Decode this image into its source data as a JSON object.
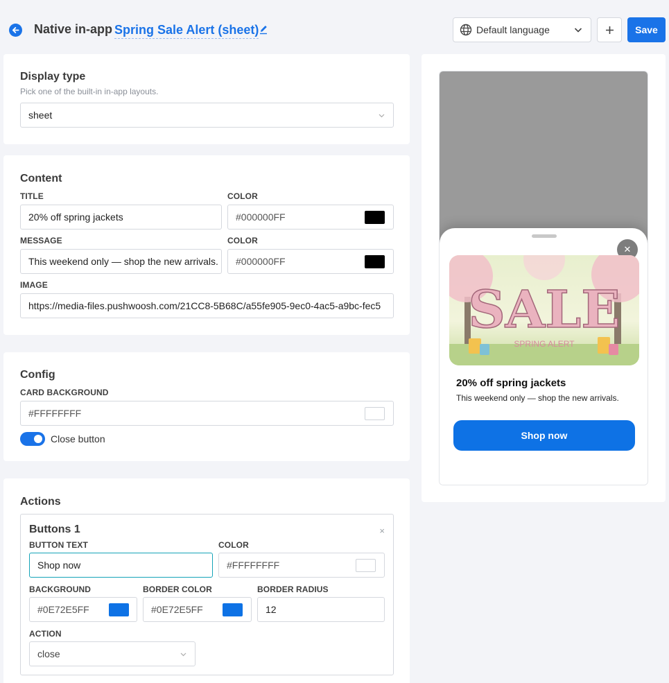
{
  "header": {
    "label": "Native in-app",
    "title": "Spring Sale Alert (sheet)",
    "language": "Default language",
    "add_label": "+",
    "save_label": "Save"
  },
  "display_type": {
    "title": "Display type",
    "subtitle": "Pick one of the built-in in-app layouts.",
    "value": "sheet"
  },
  "content": {
    "title": "Content",
    "title_label": "TITLE",
    "title_value": "20% off spring jackets",
    "title_color_label": "COLOR",
    "title_color": "#000000FF",
    "message_label": "MESSAGE",
    "message_value": "This weekend only — shop the new arrivals.",
    "message_color_label": "COLOR",
    "message_color": "#000000FF",
    "image_label": "IMAGE",
    "image_value": "https://media-files.pushwoosh.com/21CC8-5B68C/a55fe905-9ec0-4ac5-a9bc-fec5"
  },
  "config": {
    "title": "Config",
    "card_bg_label": "CARD BACKGROUND",
    "card_bg": "#FFFFFFFF",
    "close_button_label": "Close button",
    "close_button_enabled": true
  },
  "actions": {
    "title": "Actions",
    "buttons": [
      {
        "title": "Buttons 1",
        "remove": "×",
        "text_label": "BUTTON TEXT",
        "text": "Shop now",
        "color_label": "COLOR",
        "color": "#FFFFFFFF",
        "bg_label": "BACKGROUND",
        "bg": "#0E72E5FF",
        "border_color_label": "BORDER COLOR",
        "border_color": "#0E72E5FF",
        "border_radius_label": "BORDER RADIUS",
        "border_radius": "12",
        "action_label": "ACTION",
        "action": "close"
      }
    ]
  },
  "preview": {
    "image_text": "SALE",
    "image_subtext": "SPRING ALERT",
    "title": "20% off spring jackets",
    "message": "This weekend only — shop the new arrivals.",
    "button": "Shop now",
    "close_glyph": "✕"
  },
  "colors": {
    "accent": "#1a73e8",
    "button_bg": "#0E72E5",
    "title_color": "#000000",
    "message_color": "#000000"
  }
}
